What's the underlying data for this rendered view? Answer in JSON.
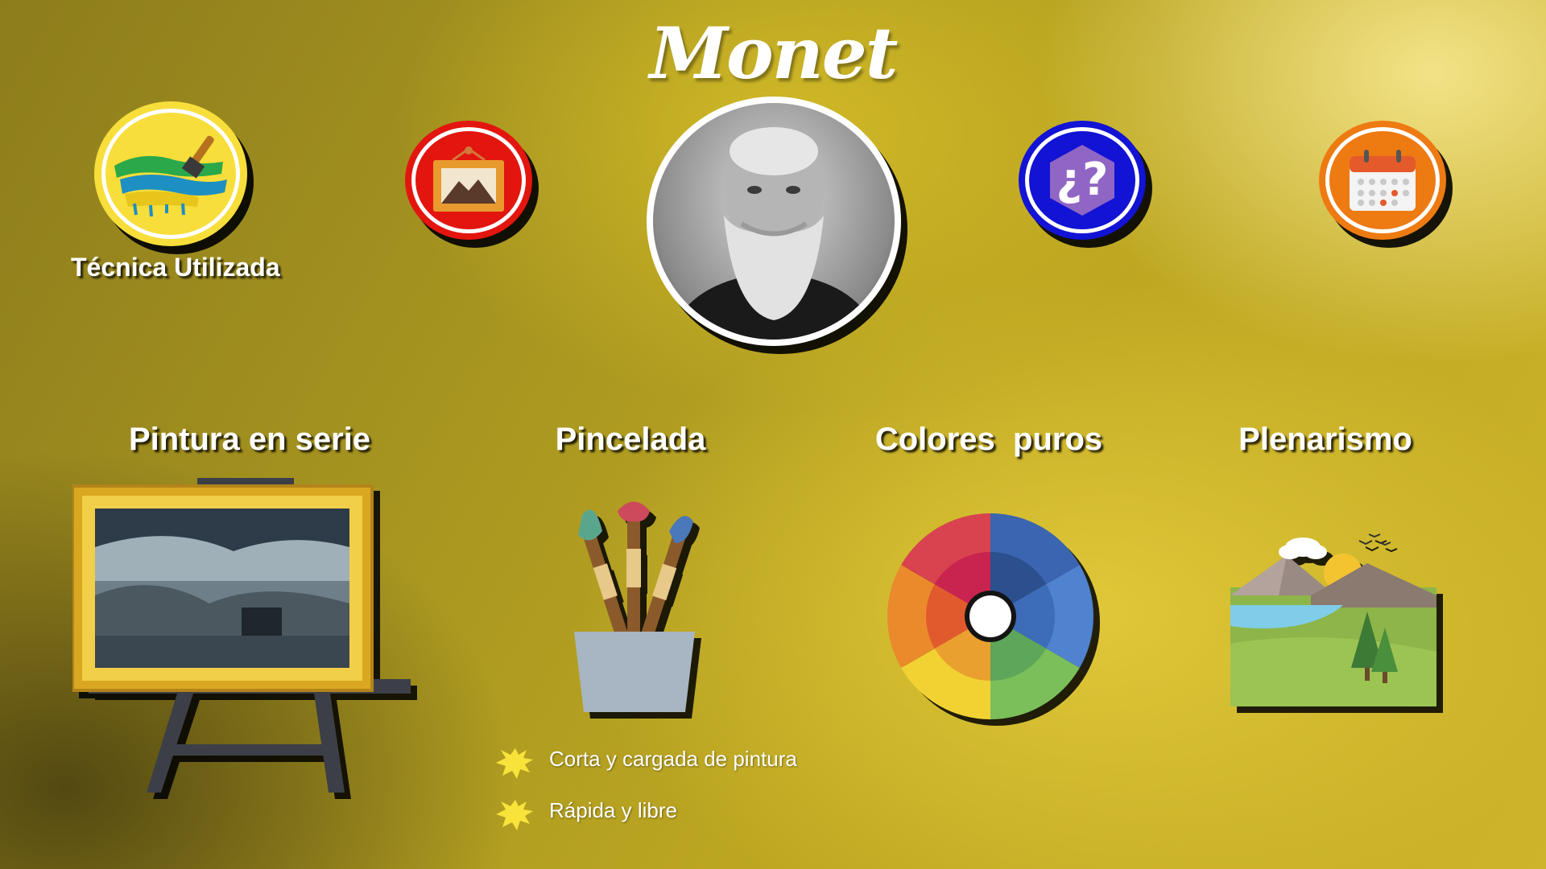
{
  "title": "Monet",
  "top_icons": {
    "technique": {
      "label": "Técnica Utilizada",
      "icon": "paintbrush-strokes-icon",
      "color": "#f7de3a"
    },
    "paintings": {
      "icon": "framed-picture-icon",
      "color": "#e3150f"
    },
    "portrait": {
      "icon": "portrait-photo"
    },
    "curiosities": {
      "icon": "question-hexagon-icon",
      "color": "#1213d4"
    },
    "timeline": {
      "icon": "calendar-icon",
      "color": "#ee7a12"
    }
  },
  "sections": [
    {
      "heading": "Pintura en serie",
      "icon": "easel-paintings-icon"
    },
    {
      "heading": "Pincelada",
      "icon": "paintbrushes-cup-icon"
    },
    {
      "heading": "Colores  puros",
      "icon": "color-wheel-icon"
    },
    {
      "heading": "Plenarismo",
      "icon": "landscape-icon"
    }
  ],
  "brushstroke_bullets": [
    "Corta y cargada de pintura",
    "Rápida y libre"
  ]
}
